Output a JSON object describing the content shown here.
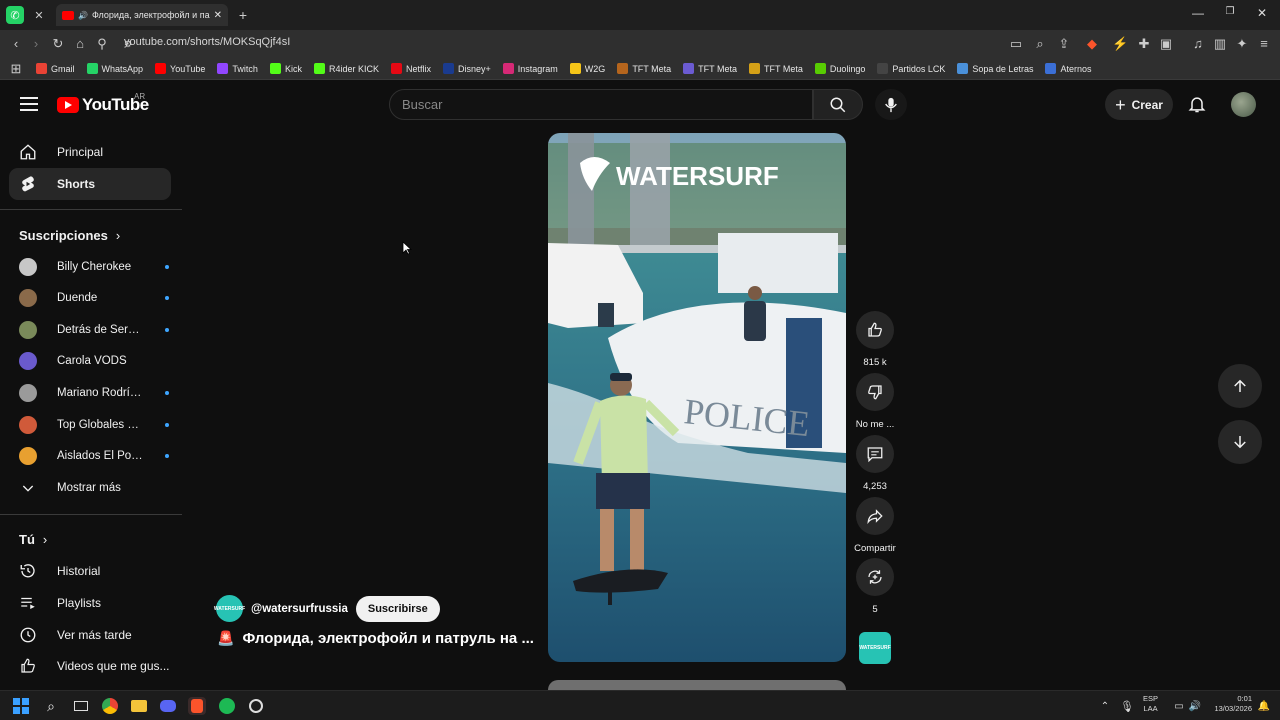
{
  "browser": {
    "tab_title": "Флорида, электрофойл и па",
    "address": "youtube.com/shorts/MOKSqQjf4sI",
    "bookmarks": [
      {
        "label": "Gmail",
        "color": "#ea4335"
      },
      {
        "label": "WhatsApp",
        "color": "#25d366"
      },
      {
        "label": "YouTube",
        "color": "#ff0000"
      },
      {
        "label": "Twitch",
        "color": "#9146ff"
      },
      {
        "label": "Kick",
        "color": "#53fc18"
      },
      {
        "label": "R4ider KICK",
        "color": "#53fc18"
      },
      {
        "label": "Netflix",
        "color": "#e50914"
      },
      {
        "label": "Disney+",
        "color": "#1a3b8f"
      },
      {
        "label": "Instagram",
        "color": "#d62976"
      },
      {
        "label": "W2G",
        "color": "#f5c518"
      },
      {
        "label": "TFT Meta",
        "color": "#b5651d"
      },
      {
        "label": "TFT Meta",
        "color": "#6b5bd2"
      },
      {
        "label": "TFT Meta",
        "color": "#d4a017"
      },
      {
        "label": "Duolingo",
        "color": "#58cc02"
      },
      {
        "label": "Partidos LCK",
        "color": "#444444"
      },
      {
        "label": "Sopa de Letras",
        "color": "#4a90d9"
      },
      {
        "label": "Aternos",
        "color": "#3b6fd6"
      }
    ]
  },
  "header": {
    "logo_text": "YouTube",
    "country": "AR",
    "search_placeholder": "Buscar",
    "create_label": "Crear"
  },
  "sidebar": {
    "main": [
      {
        "label": "Principal",
        "icon": "home-icon"
      },
      {
        "label": "Shorts",
        "icon": "shorts-icon"
      }
    ],
    "subscriptions_title": "Suscripciones",
    "subscriptions": [
      {
        "name": "Billy Cherokee",
        "color": "#c7c7c7"
      },
      {
        "name": "Duende",
        "color": "#8a6a4a"
      },
      {
        "name": "Detrás de Sergio ...",
        "color": "#7a8a5a"
      },
      {
        "name": "Carola VODS",
        "color": "#6a5acd"
      },
      {
        "name": "Mariano Rodrígu...",
        "color": "#9a9a9a"
      },
      {
        "name": "Top Globales Ext...",
        "color": "#d05a3a"
      },
      {
        "name": "Aislados El Podc...",
        "color": "#e8a030"
      }
    ],
    "show_more": "Mostrar más",
    "you_title": "Tú",
    "you_items": [
      {
        "label": "Historial",
        "icon": "history-icon"
      },
      {
        "label": "Playlists",
        "icon": "playlist-icon"
      },
      {
        "label": "Ver más tarde",
        "icon": "clock-icon"
      },
      {
        "label": "Videos que me gus...",
        "icon": "like-icon"
      }
    ]
  },
  "short": {
    "watermark": "WATERSURF",
    "boat_text": "POLICE",
    "channel_handle": "@watersurfrussia",
    "channel_avatar_text": "WATERSURF",
    "subscribe_label": "Suscribirse",
    "title": "Флорида, электрофойл и патруль на ...",
    "actions": {
      "likes": "815 k",
      "dislike": "No me ...",
      "comments": "4,253",
      "share": "Compartir",
      "remix": "5"
    }
  },
  "taskbar": {
    "lang_line1": "ESP",
    "lang_line2": "LAA",
    "time": "0:01",
    "date": "13/03/2026"
  }
}
